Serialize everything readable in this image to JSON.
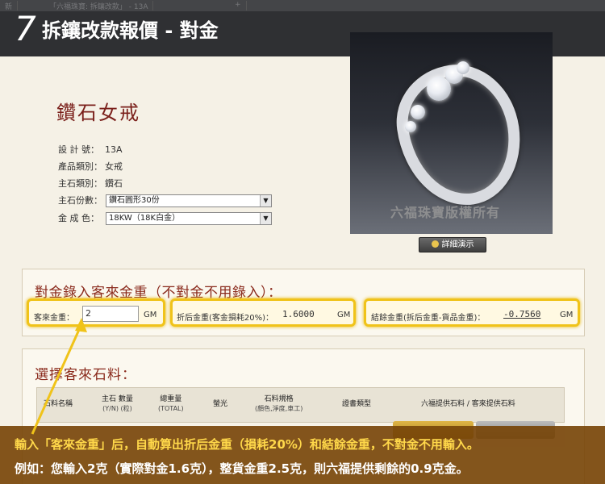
{
  "header": {
    "step_number": "7",
    "step_title": "拆鑲改款報價 - 對金",
    "ghost_tab_1": "新",
    "ghost_tab_2": "「六福珠寶: 拆鑲改款」 - 13A",
    "ghost_tab_3": "+"
  },
  "product": {
    "title": "鑽石女戒",
    "specs": [
      {
        "key": "設 計 號：",
        "value": "13A"
      },
      {
        "key": "產品類別：",
        "value": "女戒"
      },
      {
        "key": "主石類別：",
        "value": "鑽石"
      }
    ],
    "stone_count_label": "主石份數：",
    "stone_count_value": "鑽石圓形30份",
    "gold_color_label": "金 成 色：",
    "gold_color_value": "18KW（18K白金）"
  },
  "photo": {
    "watermark": "六福珠寶版權所有",
    "detail_button": "詳細演示"
  },
  "gold_section": {
    "title": "對金錄入客來金重（不對金不用錄入）：",
    "customer_weight_label": "客來金重：",
    "customer_weight_value": "2",
    "customer_weight_unit": "GM",
    "after_loss_label": "折后金重(客金損耗20%)：",
    "after_loss_value": "1.6000",
    "after_loss_unit": "GM",
    "balance_label": "結餘金重(拆后金重-貨品金重)：",
    "balance_value": "-0.7560",
    "balance_unit": "GM"
  },
  "stone_section": {
    "title": "選擇客來石料：",
    "columns": [
      {
        "label": "石料名稱",
        "sub": ""
      },
      {
        "label": "主石 數量",
        "sub": "(Y/N)  (粒)"
      },
      {
        "label": "總重量",
        "sub": "(TOTAL)"
      },
      {
        "label": "螢光",
        "sub": ""
      },
      {
        "label": "石料規格",
        "sub": "(顏色,淨度,車工)"
      },
      {
        "label": "證書類型",
        "sub": ""
      },
      {
        "label": "六福提供石料 / 客來提供石料",
        "sub": ""
      }
    ]
  },
  "caption": {
    "line1": "輸入「客來金重」后，自動算出折后金重（損耗20%）和結餘金重，不對金不用輸入。",
    "line2": "例如：您輸入2克（實際對金1.6克），整貨金重2.5克，則六福提供剩餘的0.9克金。"
  },
  "colors": {
    "banner": "#2f3033",
    "accent_red": "#8a2a1c",
    "highlight": "#f0c319",
    "caption_bg": "#78460a",
    "caption_yellow": "#ffd84a"
  }
}
